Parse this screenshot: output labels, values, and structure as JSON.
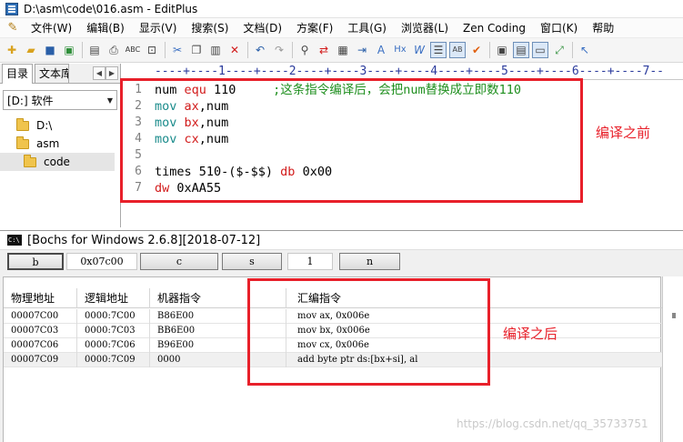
{
  "editplus": {
    "title": "D:\\asm\\code\\016.asm - EditPlus",
    "menu": [
      "文件(W)",
      "编辑(B)",
      "显示(V)",
      "搜索(S)",
      "文档(D)",
      "方案(F)",
      "工具(G)",
      "浏览器(L)",
      "Zen Coding",
      "窗口(K)",
      "帮助"
    ],
    "left_tabs": [
      "目录",
      "文本库"
    ],
    "drive": "[D:] 软件",
    "tree": [
      "D:\\",
      "asm",
      "code"
    ],
    "ruler": "----+----1----+----2----+----3----+----4----+----5----+----6----+----7--",
    "code_lines": [
      {
        "n": "1",
        "parts": [
          {
            "t": "num ",
            "c": "k-black"
          },
          {
            "t": "equ",
            "c": "k-red"
          },
          {
            "t": " 110     ",
            "c": "k-black"
          },
          {
            "t": ";这条指令编译后，会把num替换成立即数110",
            "c": "k-green"
          }
        ]
      },
      {
        "n": "2",
        "parts": [
          {
            "t": "mov ",
            "c": "k-teal"
          },
          {
            "t": "ax",
            "c": "k-red"
          },
          {
            "t": ",num",
            "c": "k-black"
          }
        ]
      },
      {
        "n": "3",
        "parts": [
          {
            "t": "mov ",
            "c": "k-teal"
          },
          {
            "t": "bx",
            "c": "k-red"
          },
          {
            "t": ",num",
            "c": "k-black"
          }
        ]
      },
      {
        "n": "4",
        "parts": [
          {
            "t": "mov ",
            "c": "k-teal"
          },
          {
            "t": "cx",
            "c": "k-red"
          },
          {
            "t": ",num",
            "c": "k-black"
          }
        ]
      },
      {
        "n": "5",
        "parts": []
      },
      {
        "n": "6",
        "parts": [
          {
            "t": "times 510-($-$$) ",
            "c": "k-black"
          },
          {
            "t": "db",
            "c": "k-red"
          },
          {
            "t": " 0x00",
            "c": "k-black"
          }
        ]
      },
      {
        "n": "7",
        "parts": [
          {
            "t": "dw",
            "c": "k-red"
          },
          {
            "t": " 0xAA55",
            "c": "k-black"
          }
        ]
      }
    ],
    "annotation_before": "编译之前"
  },
  "bochs": {
    "title": "[Bochs for Windows 2.6.8][2018-07-12]",
    "buttons": {
      "b": "b",
      "addr": "0x07c00",
      "c": "c",
      "s": "s",
      "count": "1",
      "n": "n"
    },
    "columns": [
      "物理地址",
      "逻辑地址",
      "机器指令",
      "汇编指令"
    ],
    "rows": [
      [
        "00007C00",
        "0000:7C00",
        "B86E00",
        "mov ax, 0x006e"
      ],
      [
        "00007C03",
        "0000:7C03",
        "BB6E00",
        "mov bx, 0x006e"
      ],
      [
        "00007C06",
        "0000:7C06",
        "B96E00",
        "mov cx, 0x006e"
      ],
      [
        "00007C09",
        "0000:7C09",
        "0000",
        "add byte ptr ds:[bx+si], al"
      ]
    ],
    "annotation_after": "编译之后"
  },
  "watermark": "https://blog.csdn.net/qq_35733751",
  "colors": {
    "annotation": "#e8202a",
    "keyword": "#d21b1b",
    "mnemonic": "#1a8b8b",
    "comment": "#1f8f1f",
    "ruler": "#2a3a9c"
  }
}
